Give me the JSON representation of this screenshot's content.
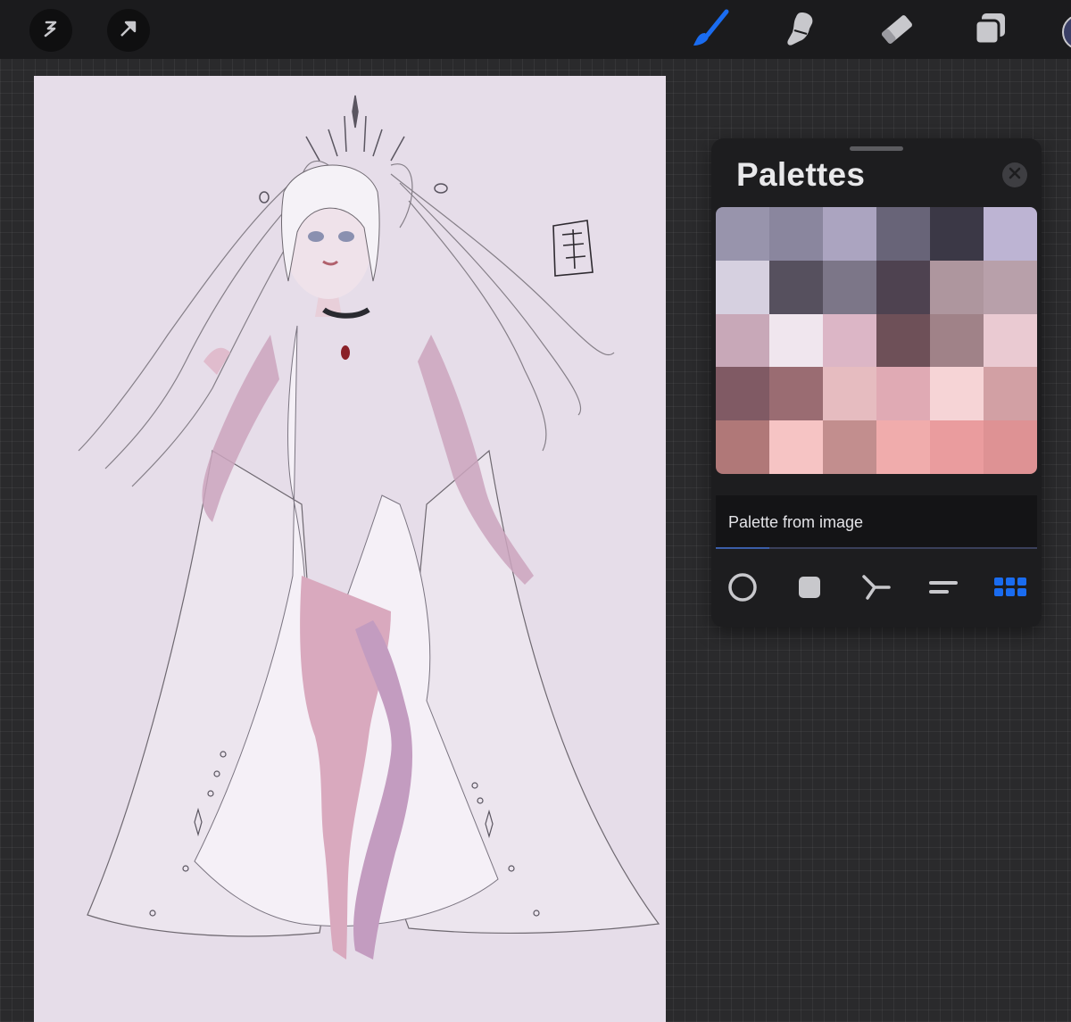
{
  "toolbar": {
    "left_buttons": [
      {
        "icon": "modify-icon"
      },
      {
        "icon": "transform-arrow-icon"
      }
    ],
    "tools": [
      {
        "icon": "brush-icon",
        "active": true
      },
      {
        "icon": "smudge-icon",
        "active": false
      },
      {
        "icon": "eraser-icon",
        "active": false
      },
      {
        "icon": "layers-icon",
        "active": false
      }
    ],
    "accent_color": "#1a6cf0"
  },
  "palettes_panel": {
    "title": "Palettes",
    "close_icon": "close-icon",
    "swatches": [
      "#9894ac",
      "#8a869e",
      "#aba4c0",
      "#686478",
      "#3b3846",
      "#bdb4d3",
      "#d6d0e0",
      "#56505e",
      "#7c7688",
      "#4e4250",
      "#ae969e",
      "#b8a0aa",
      "#c8a8b8",
      "#f0e6ee",
      "#dcb6c6",
      "#6e5058",
      "#a08288",
      "#eacad2",
      "#805a64",
      "#9a6c72",
      "#e6bcc0",
      "#e0aab4",
      "#f6d4d6",
      "#d2a0a4",
      "#b07878",
      "#f6c4c4",
      "#c28e8e",
      "#f0acac",
      "#ea9c9e",
      "#de9294"
    ],
    "palette_name": "Palette from image",
    "view_modes": [
      {
        "icon": "color-disc-icon",
        "active": false
      },
      {
        "icon": "color-square-icon",
        "active": false
      },
      {
        "icon": "harmony-icon",
        "active": false
      },
      {
        "icon": "value-sliders-icon",
        "active": false
      },
      {
        "icon": "palette-grid-icon",
        "active": true
      }
    ]
  },
  "canvas": {
    "background_color": "#e6dde9"
  }
}
